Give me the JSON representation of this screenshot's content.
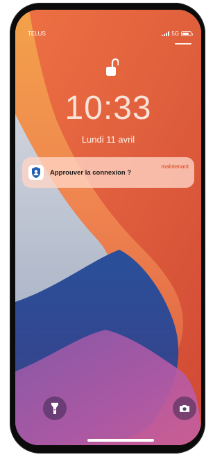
{
  "status_bar": {
    "carrier": "TELUS",
    "network": "5G",
    "icons": [
      "signal-icon",
      "battery-icon"
    ]
  },
  "lock_screen": {
    "lock_icon": "unlocked-padlock-icon",
    "time": "10:33",
    "date": "Lundi 11 avril"
  },
  "notification": {
    "app_icon": "authenticator-app-icon",
    "title": "Approuver la connexion ?",
    "timestamp": "maintenant"
  },
  "quick_actions": {
    "left": "flashlight-icon",
    "right": "camera-icon"
  },
  "colors": {
    "notification_time": "#d9441e",
    "wallpaper_orange": "#f08a4b",
    "wallpaper_red": "#e2543a",
    "wallpaper_blue": "#2f4b96"
  }
}
